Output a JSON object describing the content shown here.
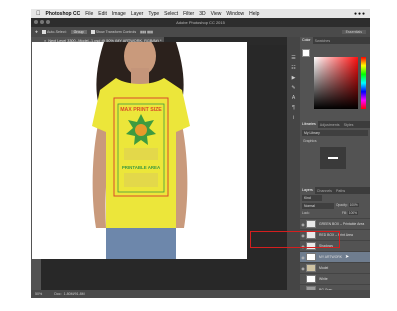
{
  "menubar": {
    "apple": "",
    "app": "Photoshop CC",
    "items": [
      "File",
      "Edit",
      "Image",
      "Layer",
      "Type",
      "Select",
      "Filter",
      "3D",
      "View",
      "Window",
      "Help"
    ]
  },
  "window_title": "Adobe Photoshop CC 2015",
  "options_bar": {
    "auto_select": "Auto-Select:",
    "group": "Group",
    "show_transform": "Show Transform Controls",
    "workspace": "Essentials"
  },
  "document_tab": "Next Level 3300--Model--1.psd @ 50% (MY ARTWORK, RGB/8#) *",
  "artwork": {
    "heading": "MAX PRINT SIZE",
    "printable": "PRINTABLE AREA"
  },
  "panels": {
    "color_tabs": [
      "Color",
      "Swatches"
    ],
    "libraries_tabs": [
      "Libraries",
      "Adjustments",
      "Styles"
    ],
    "my_library": "My Library",
    "graphics": "Graphics",
    "layers_tabs": [
      "Layers",
      "Channels",
      "Paths"
    ],
    "kind": "Kind",
    "blend_mode": "Normal",
    "opacity_label": "Opacity:",
    "opacity": "100%",
    "lock_label": "Lock:",
    "fill_label": "Fill:",
    "fill": "100%"
  },
  "layers": [
    {
      "name": "GREEN BOX – Printable Area"
    },
    {
      "name": "RED BOX – Print Area"
    },
    {
      "name": "Shadows"
    },
    {
      "name": "MY ARTWORK",
      "selected": true
    },
    {
      "name": "Model"
    },
    {
      "name": "White"
    },
    {
      "name": "BG Gray"
    }
  ],
  "status": {
    "zoom": "50%",
    "doc_label": "Doc:",
    "doc_size": "1.80M/91.8M"
  },
  "colors": {
    "shirt": "#ece63a",
    "print_red": "#d94b2a",
    "print_green": "#3f9b3f",
    "highlight": "#d41f1f"
  }
}
